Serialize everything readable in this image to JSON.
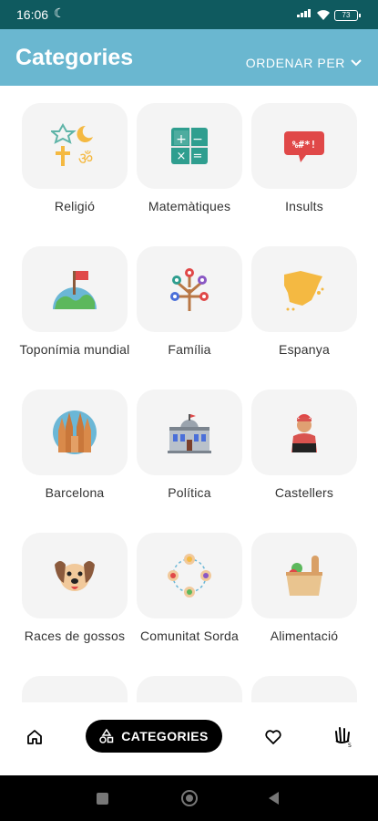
{
  "status_bar": {
    "time": "16:06",
    "battery": "73"
  },
  "header": {
    "title": "Categories",
    "sort_label": "ORDENAR PER"
  },
  "categories": [
    {
      "label": "Religió",
      "icon": "religion-symbols-icon"
    },
    {
      "label": "Matemàtiques",
      "icon": "calculator-icon"
    },
    {
      "label": "Insults",
      "icon": "swearing-speech-bubble-icon"
    },
    {
      "label": "Toponímia mundial",
      "icon": "globe-with-flag-icon"
    },
    {
      "label": "Família",
      "icon": "family-tree-icon"
    },
    {
      "label": "Espanya",
      "icon": "spain-map-icon"
    },
    {
      "label": "Barcelona",
      "icon": "sagrada-familia-icon"
    },
    {
      "label": "Política",
      "icon": "parliament-building-icon"
    },
    {
      "label": "Castellers",
      "icon": "casteller-person-icon"
    },
    {
      "label": "Races de gossos",
      "icon": "dog-face-icon"
    },
    {
      "label": "Comunitat Sorda",
      "icon": "community-people-icon"
    },
    {
      "label": "Alimentació",
      "icon": "grocery-bag-icon"
    }
  ],
  "bottom_nav": {
    "home_icon": "home-icon",
    "categories_label": "CATEGORIES",
    "favorites_icon": "heart-icon",
    "sign_icon": "sign-hand-icon"
  },
  "colors": {
    "header": "#6ab7d0",
    "status_bar": "#0f5a5f",
    "card": "#f4f4f4"
  }
}
